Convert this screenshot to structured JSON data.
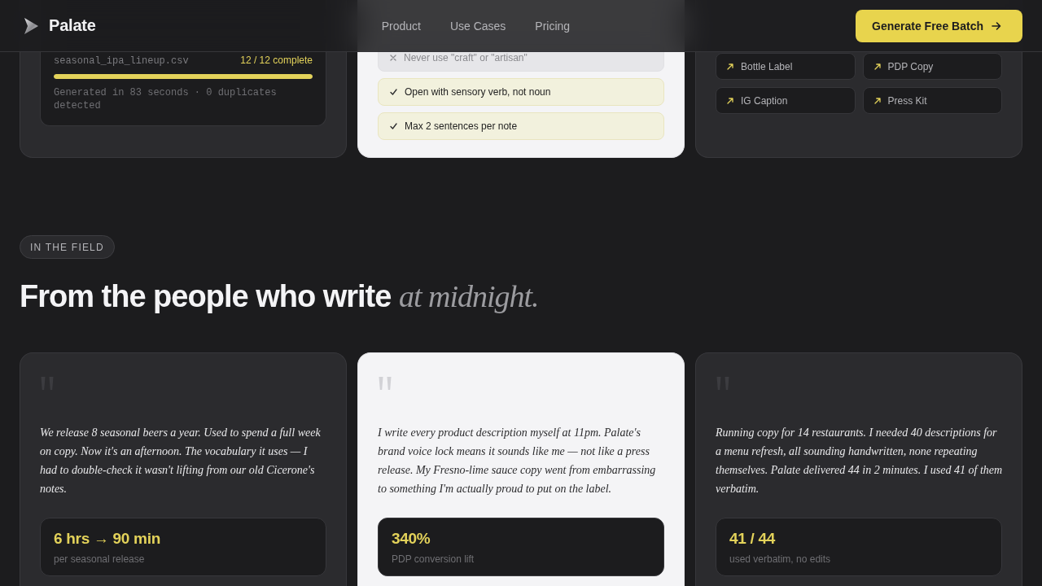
{
  "header": {
    "logo": "Palate",
    "nav": [
      "Product",
      "Use Cases",
      "Pricing"
    ],
    "cta": "Generate Free Batch"
  },
  "feature_cards": [
    {
      "kind": "batch",
      "featured": false,
      "file": "seasonal_ipa_lineup.csv",
      "status": "12 / 12 complete",
      "level": 1,
      "summary": "Generated in 83 seconds · 0 duplicates detected"
    },
    {
      "kind": "rules",
      "featured": true,
      "rules": [
        {
          "kind": "forbid",
          "text": "Never use \"craft\" or \"artisan\""
        },
        {
          "kind": "require",
          "text": "Open with sensory verb, not noun"
        },
        {
          "kind": "require",
          "text": "Max 2 sentences per note"
        }
      ]
    },
    {
      "kind": "formats",
      "featured": false,
      "formats": [
        "Bottle Label",
        "PDP Copy",
        "IG Caption",
        "Press Kit"
      ]
    }
  ],
  "section": {
    "eyebrow": "IN THE FIELD",
    "heading": "From the people who write *at midnight.*"
  },
  "testimonials": [
    {
      "featured": false,
      "quote": "We release 8 seasonal beers a year. Used to spend a full week on copy. Now it's an afternoon. The vocabulary it uses — I had to double-check it wasn't lifting from our old Cicerone's notes.",
      "stat_value": "6 hrs → 90 min",
      "stat_label": "per seasonal release"
    },
    {
      "featured": true,
      "quote": "I write every product description myself at 11pm. Palate's brand voice lock means it sounds like me — not like a press release. My Fresno-lime sauce copy went from embarrassing to something I'm actually proud to put on the label.",
      "stat_value": "340%",
      "stat_label": "PDP conversion lift"
    },
    {
      "featured": false,
      "quote": "Running copy for 14 restaurants. I needed 40 descriptions for a menu refresh, all sounding handwritten, none repeating themselves. Palate delivered 44 in 2 minutes. I used 41 of them verbatim.",
      "stat_value": "41 / 44",
      "stat_label": "used verbatim, no edits"
    }
  ]
}
